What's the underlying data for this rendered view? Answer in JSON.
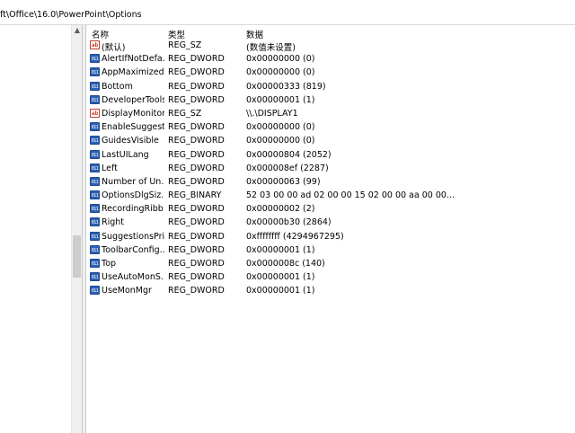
{
  "address": {
    "path": "ft\\Office\\16.0\\PowerPoint\\Options"
  },
  "tree": {
    "scroll_up_glyph": "▲"
  },
  "columns": {
    "name": "名称",
    "type": "类型",
    "data": "数据"
  },
  "rows": [
    {
      "icon": "ab",
      "name": "(默认)",
      "type": "REG_SZ",
      "data": "(数值未设置)"
    },
    {
      "icon": "bin",
      "name": "AlertIfNotDefa...",
      "type": "REG_DWORD",
      "data": "0x00000000 (0)"
    },
    {
      "icon": "bin",
      "name": "AppMaximized",
      "type": "REG_DWORD",
      "data": "0x00000000 (0)"
    },
    {
      "icon": "bin",
      "name": "Bottom",
      "type": "REG_DWORD",
      "data": "0x00000333 (819)"
    },
    {
      "icon": "bin",
      "name": "DeveloperTools",
      "type": "REG_DWORD",
      "data": "0x00000001 (1)"
    },
    {
      "icon": "ab",
      "name": "DisplayMonitor",
      "type": "REG_SZ",
      "data": "\\\\.\\DISPLAY1"
    },
    {
      "icon": "bin",
      "name": "EnableSuggest...",
      "type": "REG_DWORD",
      "data": "0x00000000 (0)"
    },
    {
      "icon": "bin",
      "name": "GuidesVisible",
      "type": "REG_DWORD",
      "data": "0x00000000 (0)"
    },
    {
      "icon": "bin",
      "name": "LastUILang",
      "type": "REG_DWORD",
      "data": "0x00000804 (2052)"
    },
    {
      "icon": "bin",
      "name": "Left",
      "type": "REG_DWORD",
      "data": "0x000008ef (2287)"
    },
    {
      "icon": "bin",
      "name": "Number of Un...",
      "type": "REG_DWORD",
      "data": "0x00000063 (99)"
    },
    {
      "icon": "bin",
      "name": "OptionsDlgSiz...",
      "type": "REG_BINARY",
      "data": "52 03 00 00 ad 02 00 00 15 02 00 00 aa 00 00..."
    },
    {
      "icon": "bin",
      "name": "RecordingRibb...",
      "type": "REG_DWORD",
      "data": "0x00000002 (2)"
    },
    {
      "icon": "bin",
      "name": "Right",
      "type": "REG_DWORD",
      "data": "0x00000b30 (2864)"
    },
    {
      "icon": "bin",
      "name": "SuggestionsPri...",
      "type": "REG_DWORD",
      "data": "0xffffffff (4294967295)"
    },
    {
      "icon": "bin",
      "name": "ToolbarConfig...",
      "type": "REG_DWORD",
      "data": "0x00000001 (1)"
    },
    {
      "icon": "bin",
      "name": "Top",
      "type": "REG_DWORD",
      "data": "0x0000008c (140)"
    },
    {
      "icon": "bin",
      "name": "UseAutoMonS...",
      "type": "REG_DWORD",
      "data": "0x00000001 (1)"
    },
    {
      "icon": "bin",
      "name": "UseMonMgr",
      "type": "REG_DWORD",
      "data": "0x00000001 (1)"
    }
  ]
}
